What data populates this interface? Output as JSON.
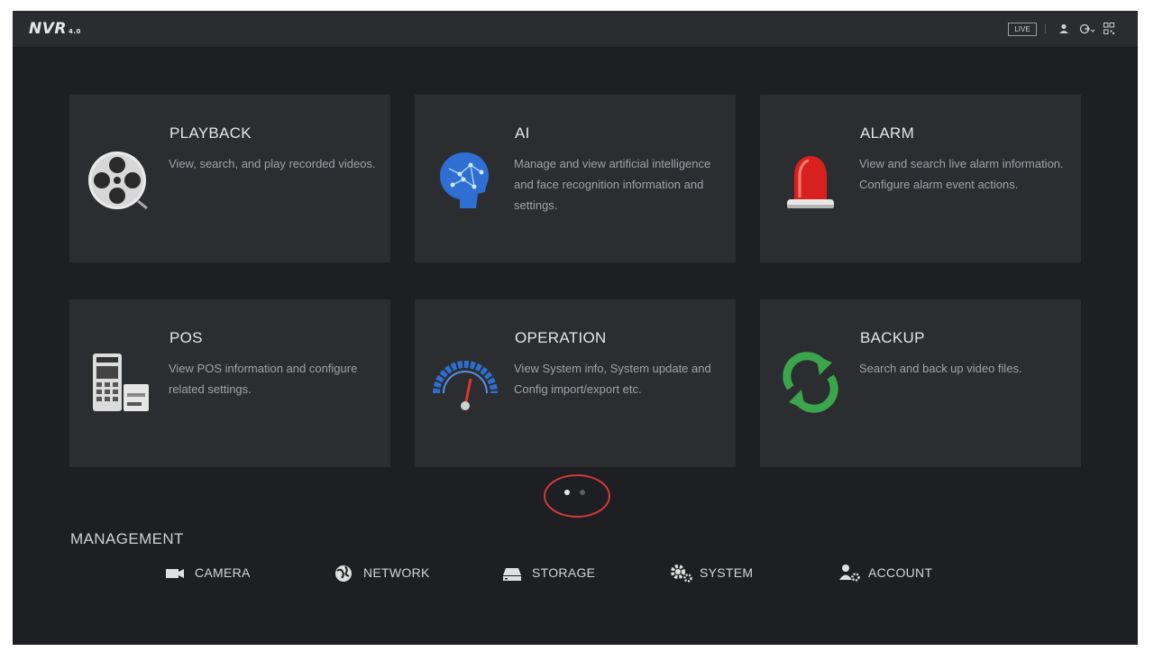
{
  "app": {
    "logo": "NVR",
    "logo_version": "4.0"
  },
  "topbar": {
    "live_label": "LIVE",
    "icons": [
      "user-icon",
      "logout-icon",
      "qr-code-icon"
    ]
  },
  "cards": [
    {
      "title": "PLAYBACK",
      "description": "View, search, and play recorded videos.",
      "icon": "film-reel-icon"
    },
    {
      "title": "AI",
      "description": "Manage and view artificial intelligence and face recognition information and settings.",
      "icon": "ai-head-icon"
    },
    {
      "title": "ALARM",
      "description": "View and search live alarm information. Configure alarm event actions.",
      "icon": "alarm-light-icon"
    },
    {
      "title": "POS",
      "description": "View POS information and configure related settings.",
      "icon": "pos-terminal-icon"
    },
    {
      "title": "OPERATION",
      "description": "View System info, System update and Config import/export etc.",
      "icon": "gauge-icon"
    },
    {
      "title": "BACKUP",
      "description": "Search and back up video files.",
      "icon": "refresh-arrows-icon"
    }
  ],
  "pagination": {
    "current_page": 1,
    "total_pages": 2
  },
  "management": {
    "title": "MANAGEMENT",
    "items": [
      {
        "label": "CAMERA",
        "icon": "camera-icon"
      },
      {
        "label": "NETWORK",
        "icon": "network-globe-icon"
      },
      {
        "label": "STORAGE",
        "icon": "storage-drive-icon"
      },
      {
        "label": "SYSTEM",
        "icon": "gears-icon"
      },
      {
        "label": "ACCOUNT",
        "icon": "account-gear-icon"
      }
    ]
  },
  "colors": {
    "background": "#1d1f22",
    "card": "#2b2d31",
    "highlight_ring": "#d43a3a"
  }
}
